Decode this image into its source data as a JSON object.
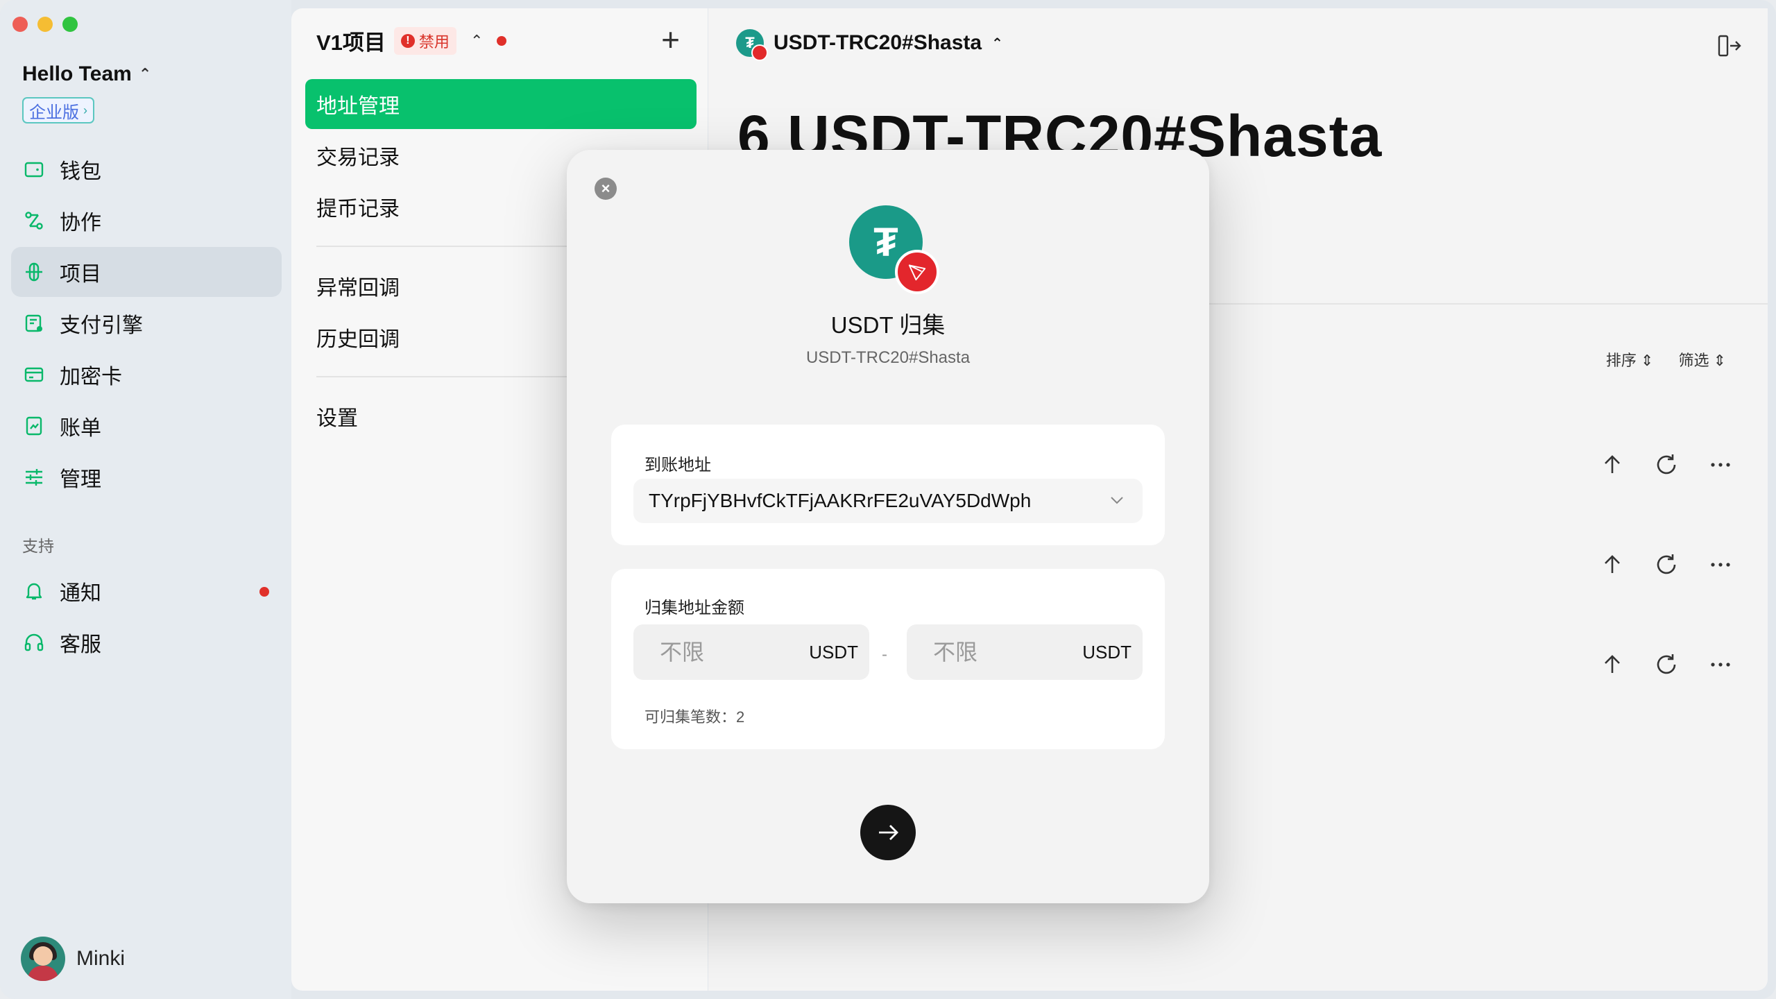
{
  "sidebar": {
    "team": "Hello Team",
    "edition": "企业版",
    "items": [
      {
        "label": "钱包"
      },
      {
        "label": "协作"
      },
      {
        "label": "项目"
      },
      {
        "label": "支付引擎"
      },
      {
        "label": "加密卡"
      },
      {
        "label": "账单"
      },
      {
        "label": "管理"
      }
    ],
    "support_title": "支持",
    "support_items": [
      {
        "label": "通知"
      },
      {
        "label": "客服"
      }
    ],
    "user": "Minki"
  },
  "project": {
    "title": "V1项目",
    "badge": "禁用",
    "menu": [
      {
        "label": "地址管理"
      },
      {
        "label": "交易记录"
      },
      {
        "label": "提币记录"
      },
      {
        "label": "异常回调"
      },
      {
        "label": "历史回调"
      },
      {
        "label": "设置"
      }
    ]
  },
  "main": {
    "coin": "USDT-TRC20#Shasta",
    "big_title": "6 USDT-TRC20#Shasta",
    "sort": "排序",
    "filter": "筛选"
  },
  "modal": {
    "title": "USDT 归集",
    "subtitle": "USDT-TRC20#Shasta",
    "address_label": "到账地址",
    "address_value": "TYrpFjYBHvfCkTFjAAKRrFE2uVAY5DdWph",
    "amount_label": "归集地址金额",
    "min_placeholder": "不限",
    "max_placeholder": "不限",
    "unit": "USDT",
    "separator": "-",
    "count_label": "可归集笔数：",
    "count_value": "2"
  },
  "colors": {
    "accent_green": "#08c16d",
    "danger_red": "#e0302a",
    "tether_teal": "#1a9a88",
    "tron_red": "#e3262c"
  }
}
